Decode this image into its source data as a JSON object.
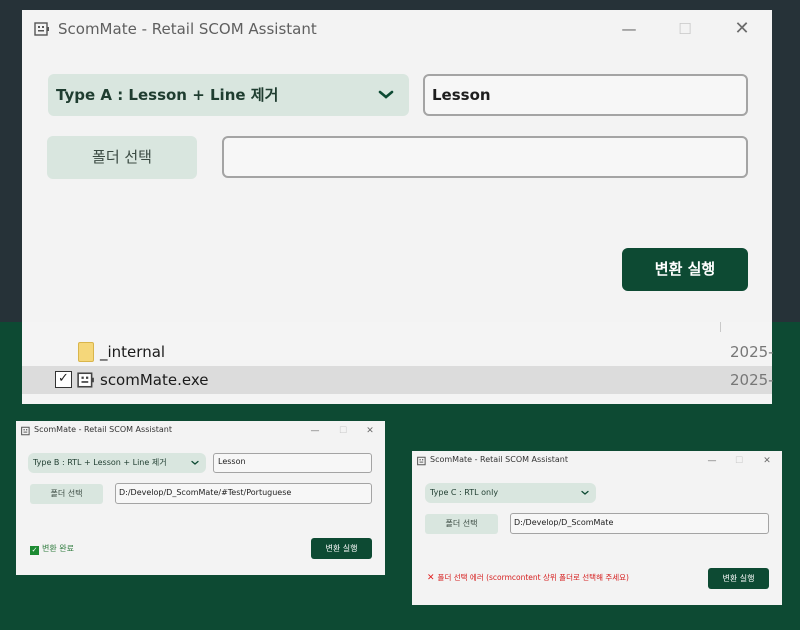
{
  "main_window": {
    "title": "ScomMate - Retail SCOM Assistant",
    "controls": {
      "minimize": "—",
      "maximize": "☐",
      "close": "✕"
    },
    "type_select": {
      "selected": "Type A : Lesson + Line 제거"
    },
    "keyword_input": {
      "value": "Lesson"
    },
    "folder_button": "폴더 선택",
    "folder_path": {
      "value": ""
    },
    "run_button": "변환 실행"
  },
  "explorer": {
    "rows": [
      {
        "name": "_internal",
        "date": "2025-",
        "selected": false
      },
      {
        "name": "scomMate.exe",
        "date": "2025-",
        "selected": true
      }
    ]
  },
  "window_b": {
    "title": "ScomMate - Retail SCOM Assistant",
    "controls": {
      "minimize": "—",
      "maximize": "☐",
      "close": "✕"
    },
    "type_select": {
      "selected": "Type B : RTL + Lesson + Line 제거"
    },
    "keyword_input": {
      "value": "Lesson"
    },
    "folder_button": "폴더 선택",
    "folder_path": {
      "value": "D:/Develop/D_ScomMate/#Test/Portuguese"
    },
    "status": "변환 완료",
    "run_button": "변환 실행"
  },
  "window_c": {
    "title": "ScomMate - Retail SCOM Assistant",
    "controls": {
      "minimize": "—",
      "maximize": "☐",
      "close": "✕"
    },
    "type_select": {
      "selected": "Type C : RTL only"
    },
    "folder_button": "폴더 선택",
    "folder_path": {
      "value": "D:/Develop/D_ScomMate"
    },
    "status": "폴더 선택 에러 (scormcontent 상위 폴더로 선택해 주세요)",
    "run_button": "변환 실행"
  },
  "colors": {
    "brand_green": "#0d4a33",
    "button_mint": "#d9e6df",
    "background_dark": "#263238",
    "success": "#1c8a32",
    "error": "#d62020"
  }
}
